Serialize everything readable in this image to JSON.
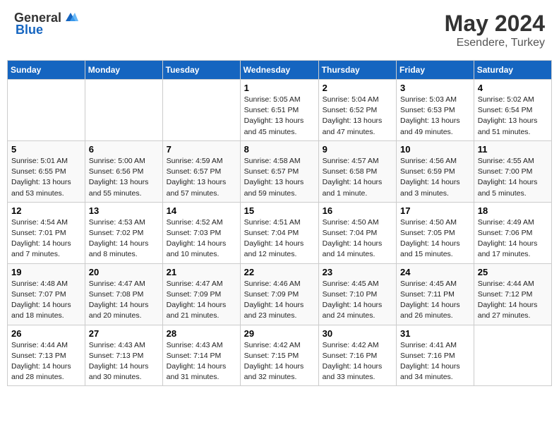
{
  "header": {
    "logo_general": "General",
    "logo_blue": "Blue",
    "month": "May 2024",
    "location": "Esendere, Turkey"
  },
  "weekdays": [
    "Sunday",
    "Monday",
    "Tuesday",
    "Wednesday",
    "Thursday",
    "Friday",
    "Saturday"
  ],
  "weeks": [
    [
      {
        "day": null,
        "detail": null
      },
      {
        "day": null,
        "detail": null
      },
      {
        "day": null,
        "detail": null
      },
      {
        "day": "1",
        "detail": "Sunrise: 5:05 AM\nSunset: 6:51 PM\nDaylight: 13 hours\nand 45 minutes."
      },
      {
        "day": "2",
        "detail": "Sunrise: 5:04 AM\nSunset: 6:52 PM\nDaylight: 13 hours\nand 47 minutes."
      },
      {
        "day": "3",
        "detail": "Sunrise: 5:03 AM\nSunset: 6:53 PM\nDaylight: 13 hours\nand 49 minutes."
      },
      {
        "day": "4",
        "detail": "Sunrise: 5:02 AM\nSunset: 6:54 PM\nDaylight: 13 hours\nand 51 minutes."
      }
    ],
    [
      {
        "day": "5",
        "detail": "Sunrise: 5:01 AM\nSunset: 6:55 PM\nDaylight: 13 hours\nand 53 minutes."
      },
      {
        "day": "6",
        "detail": "Sunrise: 5:00 AM\nSunset: 6:56 PM\nDaylight: 13 hours\nand 55 minutes."
      },
      {
        "day": "7",
        "detail": "Sunrise: 4:59 AM\nSunset: 6:57 PM\nDaylight: 13 hours\nand 57 minutes."
      },
      {
        "day": "8",
        "detail": "Sunrise: 4:58 AM\nSunset: 6:57 PM\nDaylight: 13 hours\nand 59 minutes."
      },
      {
        "day": "9",
        "detail": "Sunrise: 4:57 AM\nSunset: 6:58 PM\nDaylight: 14 hours\nand 1 minute."
      },
      {
        "day": "10",
        "detail": "Sunrise: 4:56 AM\nSunset: 6:59 PM\nDaylight: 14 hours\nand 3 minutes."
      },
      {
        "day": "11",
        "detail": "Sunrise: 4:55 AM\nSunset: 7:00 PM\nDaylight: 14 hours\nand 5 minutes."
      }
    ],
    [
      {
        "day": "12",
        "detail": "Sunrise: 4:54 AM\nSunset: 7:01 PM\nDaylight: 14 hours\nand 7 minutes."
      },
      {
        "day": "13",
        "detail": "Sunrise: 4:53 AM\nSunset: 7:02 PM\nDaylight: 14 hours\nand 8 minutes."
      },
      {
        "day": "14",
        "detail": "Sunrise: 4:52 AM\nSunset: 7:03 PM\nDaylight: 14 hours\nand 10 minutes."
      },
      {
        "day": "15",
        "detail": "Sunrise: 4:51 AM\nSunset: 7:04 PM\nDaylight: 14 hours\nand 12 minutes."
      },
      {
        "day": "16",
        "detail": "Sunrise: 4:50 AM\nSunset: 7:04 PM\nDaylight: 14 hours\nand 14 minutes."
      },
      {
        "day": "17",
        "detail": "Sunrise: 4:50 AM\nSunset: 7:05 PM\nDaylight: 14 hours\nand 15 minutes."
      },
      {
        "day": "18",
        "detail": "Sunrise: 4:49 AM\nSunset: 7:06 PM\nDaylight: 14 hours\nand 17 minutes."
      }
    ],
    [
      {
        "day": "19",
        "detail": "Sunrise: 4:48 AM\nSunset: 7:07 PM\nDaylight: 14 hours\nand 18 minutes."
      },
      {
        "day": "20",
        "detail": "Sunrise: 4:47 AM\nSunset: 7:08 PM\nDaylight: 14 hours\nand 20 minutes."
      },
      {
        "day": "21",
        "detail": "Sunrise: 4:47 AM\nSunset: 7:09 PM\nDaylight: 14 hours\nand 21 minutes."
      },
      {
        "day": "22",
        "detail": "Sunrise: 4:46 AM\nSunset: 7:09 PM\nDaylight: 14 hours\nand 23 minutes."
      },
      {
        "day": "23",
        "detail": "Sunrise: 4:45 AM\nSunset: 7:10 PM\nDaylight: 14 hours\nand 24 minutes."
      },
      {
        "day": "24",
        "detail": "Sunrise: 4:45 AM\nSunset: 7:11 PM\nDaylight: 14 hours\nand 26 minutes."
      },
      {
        "day": "25",
        "detail": "Sunrise: 4:44 AM\nSunset: 7:12 PM\nDaylight: 14 hours\nand 27 minutes."
      }
    ],
    [
      {
        "day": "26",
        "detail": "Sunrise: 4:44 AM\nSunset: 7:13 PM\nDaylight: 14 hours\nand 28 minutes."
      },
      {
        "day": "27",
        "detail": "Sunrise: 4:43 AM\nSunset: 7:13 PM\nDaylight: 14 hours\nand 30 minutes."
      },
      {
        "day": "28",
        "detail": "Sunrise: 4:43 AM\nSunset: 7:14 PM\nDaylight: 14 hours\nand 31 minutes."
      },
      {
        "day": "29",
        "detail": "Sunrise: 4:42 AM\nSunset: 7:15 PM\nDaylight: 14 hours\nand 32 minutes."
      },
      {
        "day": "30",
        "detail": "Sunrise: 4:42 AM\nSunset: 7:16 PM\nDaylight: 14 hours\nand 33 minutes."
      },
      {
        "day": "31",
        "detail": "Sunrise: 4:41 AM\nSunset: 7:16 PM\nDaylight: 14 hours\nand 34 minutes."
      },
      {
        "day": null,
        "detail": null
      }
    ]
  ]
}
